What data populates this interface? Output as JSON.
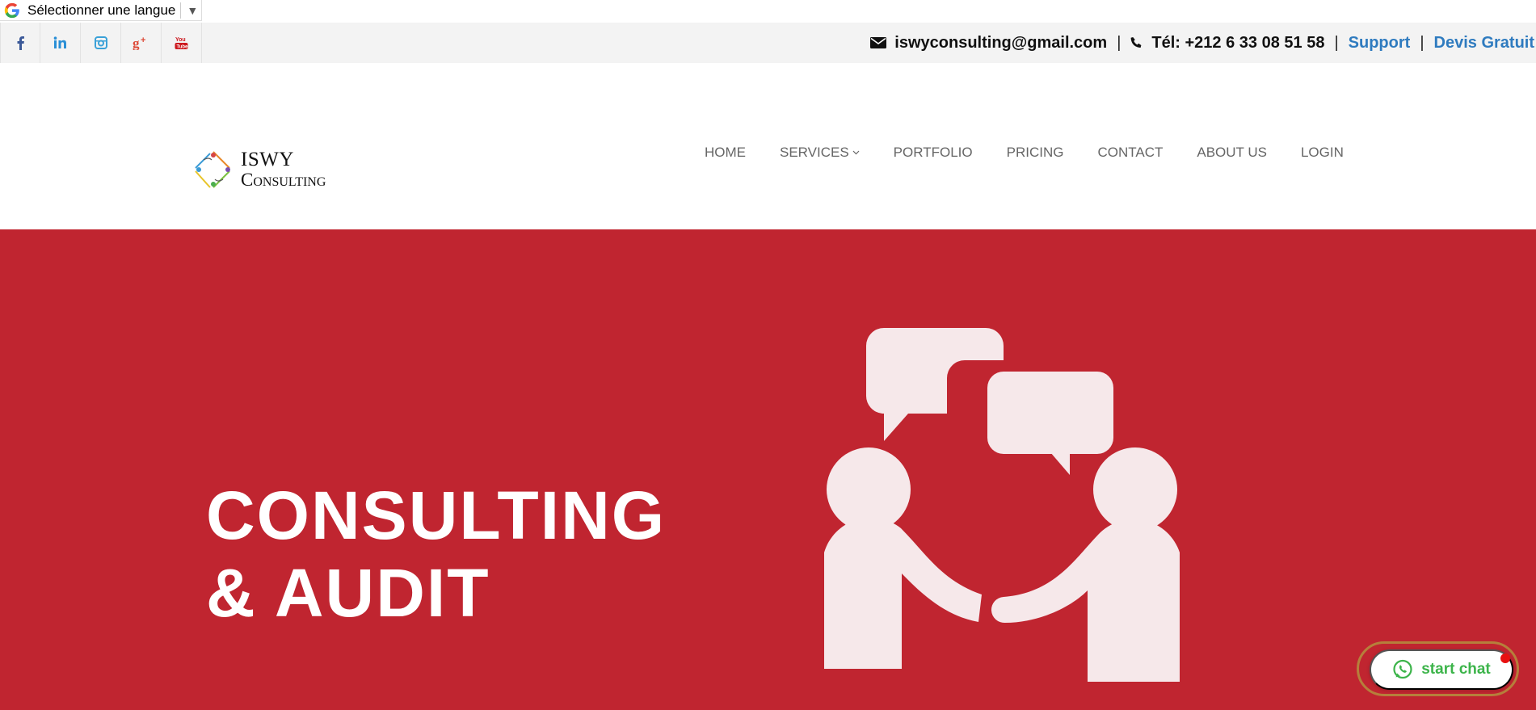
{
  "translate": {
    "label": "Sélectionner une langue",
    "arrow": "▼"
  },
  "social": [
    {
      "name": "facebook-icon",
      "glyph": "f",
      "color": "#3b5998"
    },
    {
      "name": "linkedin-icon",
      "glyph": "in",
      "color": "#2a8fd6"
    },
    {
      "name": "instagram-icon",
      "glyph": "",
      "color": "#3aa1d8"
    },
    {
      "name": "google-plus-icon",
      "glyph": "g+",
      "color": "#dd4b39"
    },
    {
      "name": "youtube-icon",
      "glyph": "You",
      "color": "#cc181e"
    }
  ],
  "contact": {
    "email": "iswyconsulting@gmail.com",
    "phone": "Tél: +212 6 33 08 51 58",
    "separator": "|",
    "support": "Support",
    "quote": "Devis Gratuit"
  },
  "logo": {
    "line1": "ISWY",
    "line2": "Consulting"
  },
  "nav": {
    "home": "HOME",
    "services": "SERVICES",
    "portfolio": "PORTFOLIO",
    "pricing": "PRICING",
    "contact": "CONTACT",
    "about": "ABOUT US",
    "login": "LOGIN"
  },
  "hero": {
    "line1": "CONSULTING",
    "line2": "& AUDIT",
    "background": "#c02530"
  },
  "chat": {
    "label": "start chat",
    "accent": "#3cb44a"
  },
  "colors": {
    "link": "#2f7bbf",
    "nav": "#666666"
  }
}
